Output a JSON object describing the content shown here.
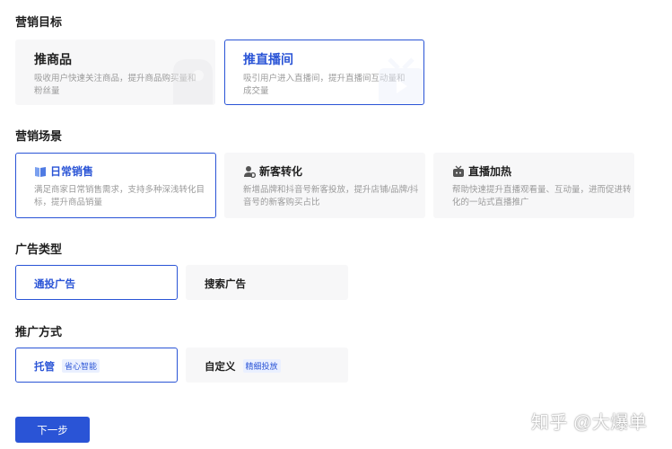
{
  "sections": {
    "goal": "营销目标",
    "scene": "营销场景",
    "ad_type": "广告类型",
    "method": "推广方式"
  },
  "goals": [
    {
      "title": "推商品",
      "desc": "吸收用户快速关注商品，提升商品购买量和粉丝量",
      "selected": false
    },
    {
      "title": "推直播间",
      "desc": "吸引用户进入直播间，提升直播间互动量和成交量",
      "selected": true
    }
  ],
  "scenes": [
    {
      "icon": "book-icon",
      "title": "日常销售",
      "desc": "满足商家日常销售需求，支持多种深浅转化目标，提升商品销量",
      "selected": true
    },
    {
      "icon": "user-gear-icon",
      "title": "新客转化",
      "desc": "新增品牌和抖音号新客投放，提升店铺/品牌/抖音号的新客购买占比",
      "selected": false
    },
    {
      "icon": "tv-icon",
      "title": "直播加热",
      "desc": "帮助快速提升直播观看量、互动量，进而促进转化的一站式直播推广",
      "selected": false
    }
  ],
  "ad_types": [
    {
      "label": "通投广告",
      "selected": true
    },
    {
      "label": "搜索广告",
      "selected": false
    }
  ],
  "methods": [
    {
      "label": "托管",
      "tag": "省心智能",
      "selected": true
    },
    {
      "label": "自定义",
      "tag": "精细投放",
      "selected": false
    }
  ],
  "next_button": "下一步",
  "watermark": "知乎 @大爆单",
  "colors": {
    "accent": "#2a54d6",
    "card_bg": "#f7f7f8",
    "tag_bg": "#eaf0ff"
  }
}
